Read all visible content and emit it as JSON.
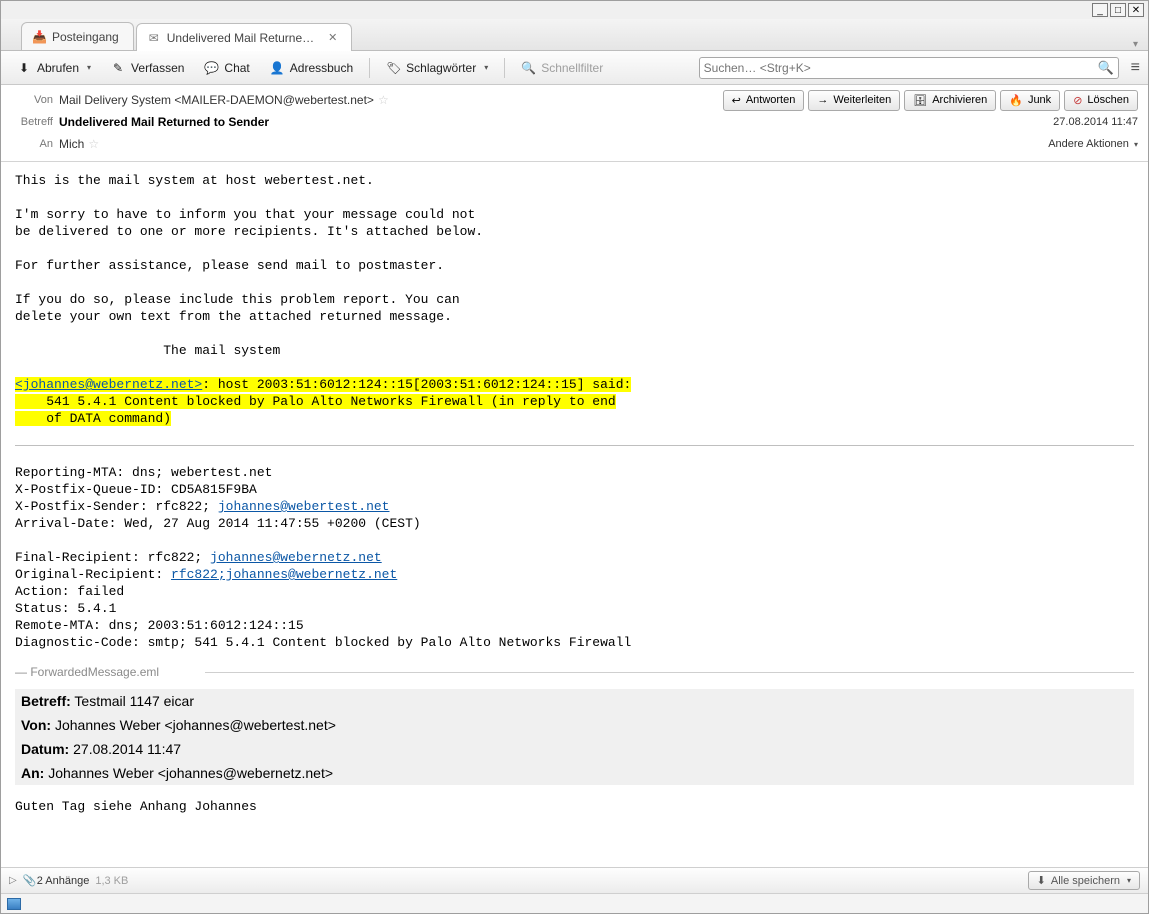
{
  "tabs": {
    "inbox": "Posteingang",
    "active": "Undelivered Mail Returne…"
  },
  "toolbar": {
    "download": "Abrufen",
    "compose": "Verfassen",
    "chat": "Chat",
    "addressbook": "Adressbuch",
    "tags": "Schlagwörter",
    "quickfilter": "Schnellfilter",
    "search_placeholder": "Suchen… <Strg+K>"
  },
  "actions": {
    "reply": "Antworten",
    "forward": "Weiterleiten",
    "archive": "Archivieren",
    "junk": "Junk",
    "delete": "Löschen"
  },
  "header": {
    "from_label": "Von",
    "from_value": "Mail Delivery System <MAILER-DAEMON@webertest.net>",
    "subject_label": "Betreff",
    "subject_value": "Undelivered Mail Returned to Sender",
    "to_label": "An",
    "to_value": "Mich",
    "datetime": "27.08.2014 11:47",
    "other_actions": "Andere Aktionen"
  },
  "body": {
    "intro": "This is the mail system at host webertest.net.\n\nI'm sorry to have to inform you that your message could not\nbe delivered to one or more recipients. It's attached below.\n\nFor further assistance, please send mail to postmaster.\n\nIf you do so, please include this problem report. You can\ndelete your own text from the attached returned message.\n\n                   The mail system",
    "hl_link": "<johannes@webernetz.net>",
    "hl_rest": ": host 2003:51:6012:124::15[2003:51:6012:124::15] said:\n    541 5.4.1 Content blocked by Palo Alto Networks Firewall (in reply to end\n    of DATA command)",
    "report1": "Reporting-MTA: dns; webertest.net\nX-Postfix-Queue-ID: CD5A815F9BA\nX-Postfix-Sender: rfc822; ",
    "report1_link": "johannes@webertest.net",
    "report2": "\nArrival-Date: Wed, 27 Aug 2014 11:47:55 +0200 (CEST)\n\nFinal-Recipient: rfc822; ",
    "report2_link": "johannes@webernetz.net",
    "report3": "\nOriginal-Recipient: ",
    "report3_link": "rfc822;johannes@webernetz.net",
    "report4": "\nAction: failed\nStatus: 5.4.1\nRemote-MTA: dns; 2003:51:6012:124::15\nDiagnostic-Code: smtp; 541 5.4.1 Content blocked by Palo Alto Networks Firewall",
    "fwd_legend": "ForwardedMessage.eml",
    "emb_subject_lab": "Betreff:",
    "emb_subject_val": " Testmail 1147 eicar",
    "emb_from_lab": "Von:",
    "emb_from_val": " Johannes Weber <johannes@webertest.net>",
    "emb_date_lab": "Datum:",
    "emb_date_val": " 27.08.2014 11:47",
    "emb_to_lab": "An:",
    "emb_to_val": " Johannes Weber <johannes@webernetz.net>",
    "emb_body": "Guten Tag siehe Anhang Johannes"
  },
  "attach": {
    "count": "2 Anhänge",
    "size": "1,3 KB",
    "save": "Alle speichern"
  }
}
